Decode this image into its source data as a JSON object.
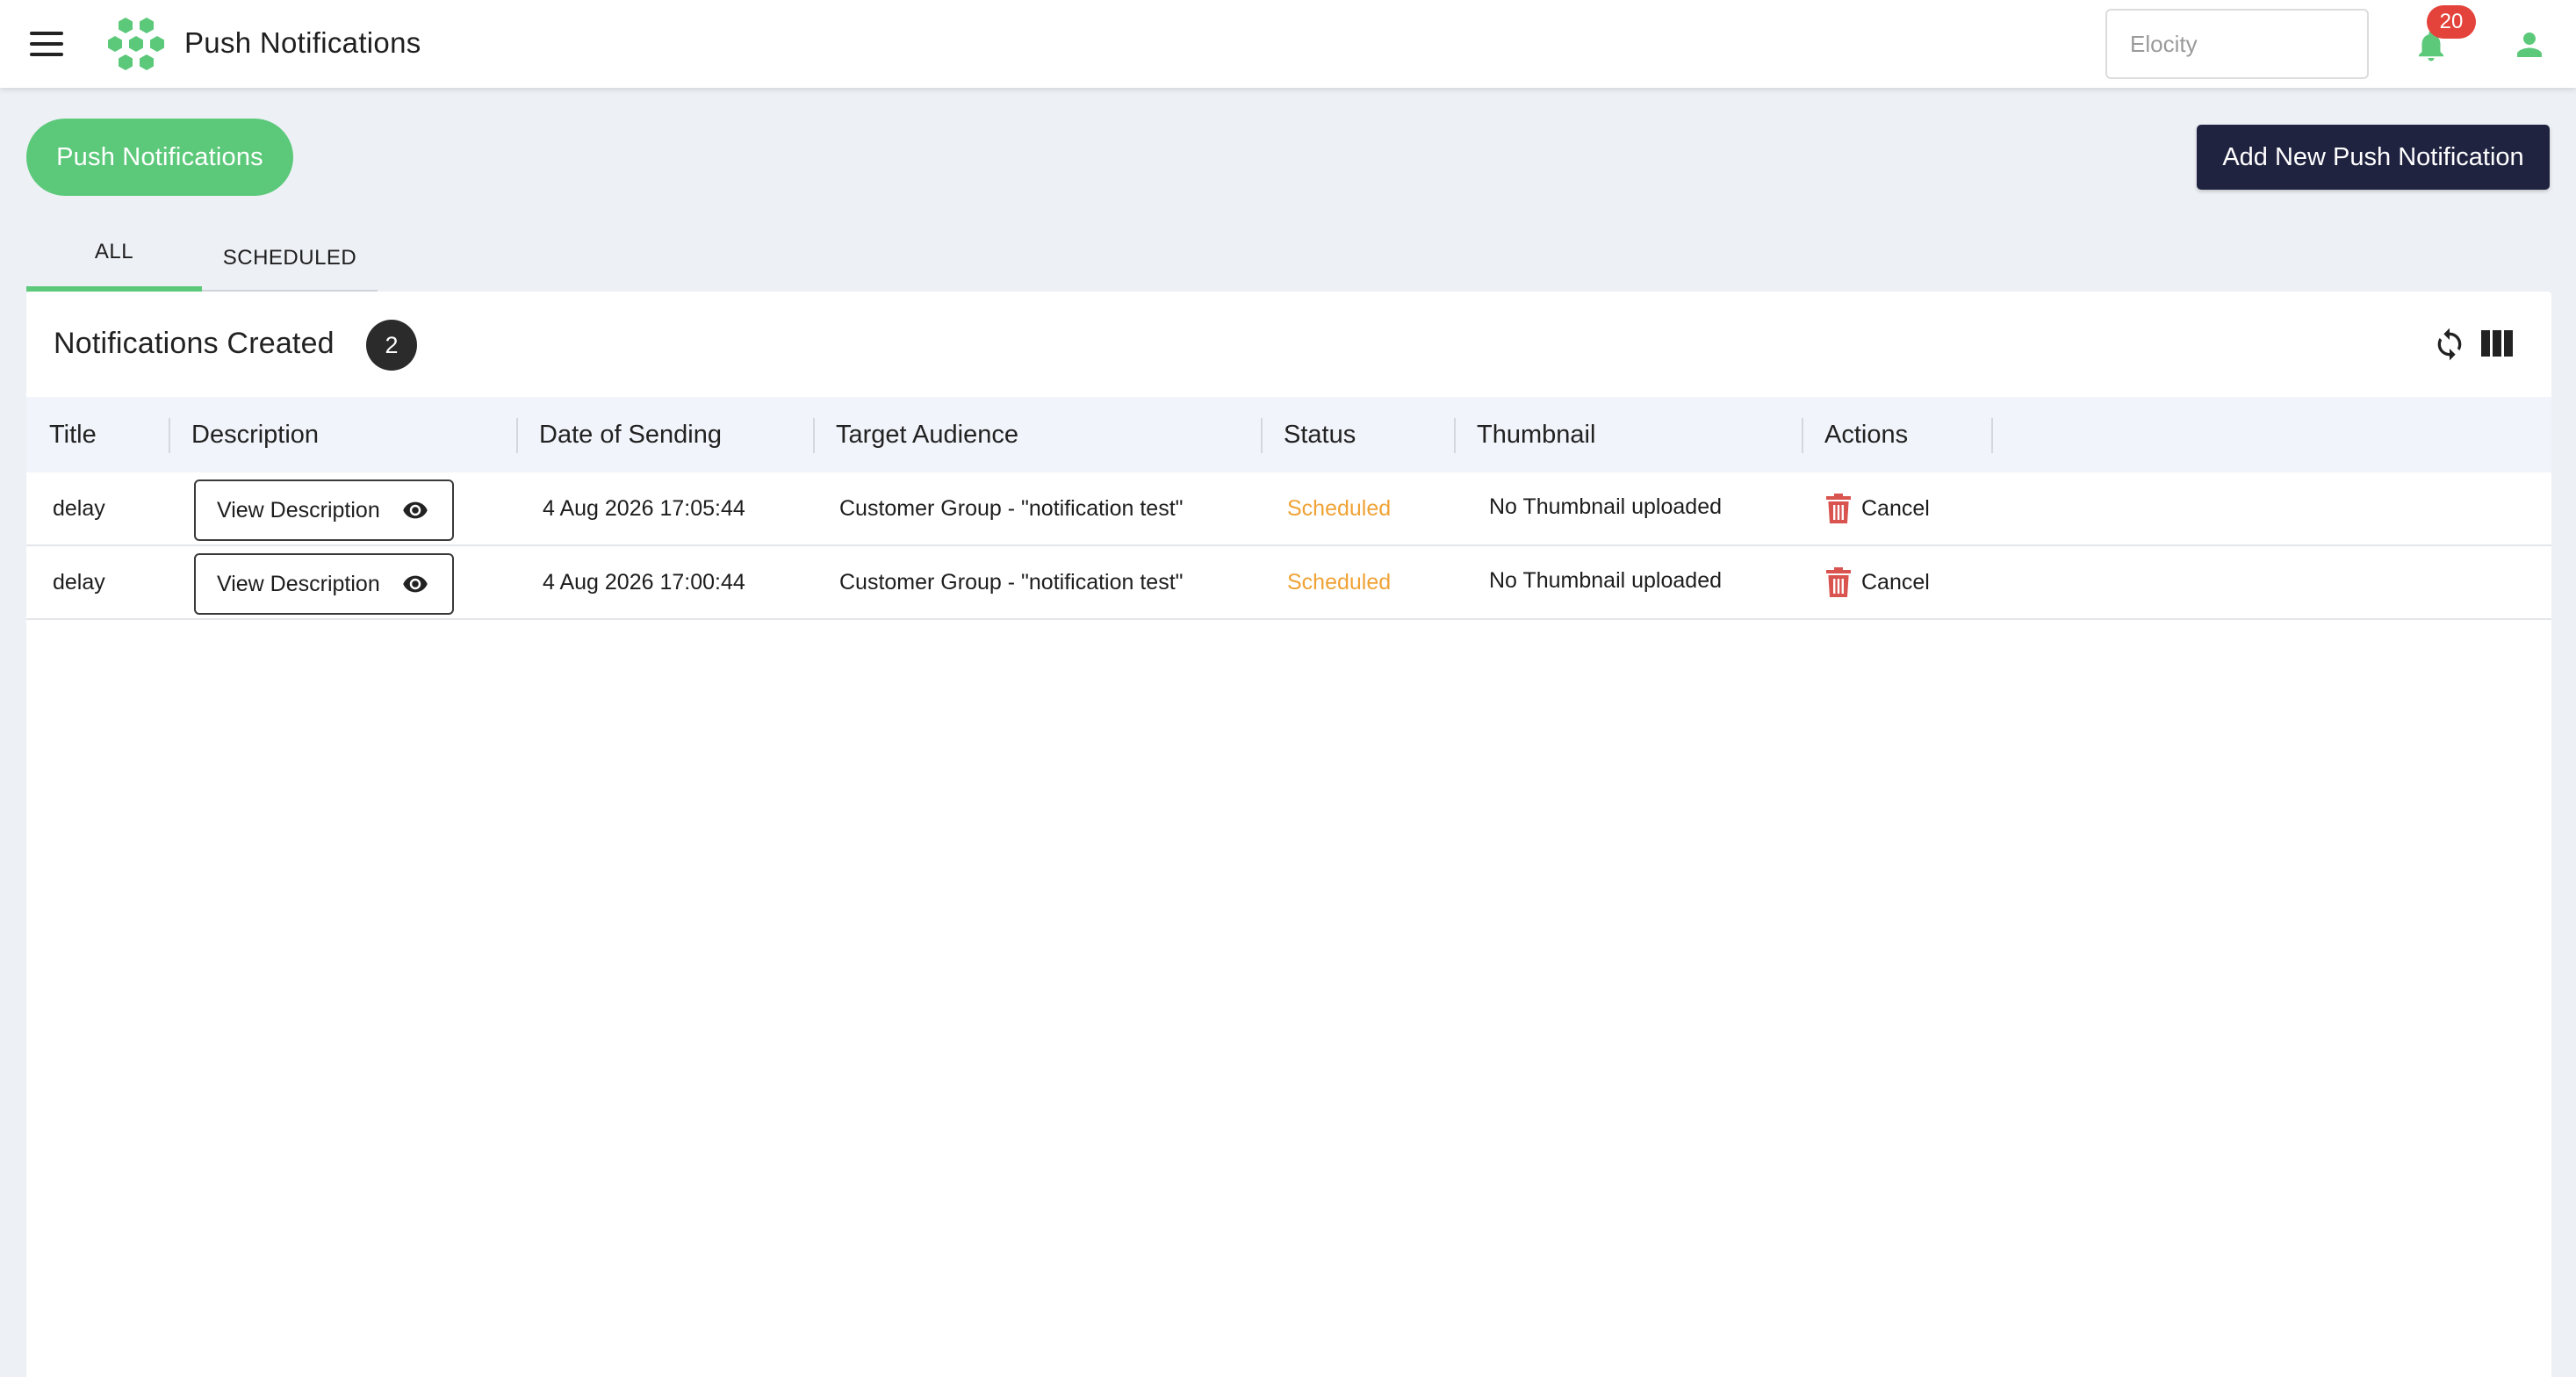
{
  "topbar": {
    "app_title": "Push Notifications",
    "org_placeholder": "Elocity",
    "notification_count": "20",
    "icons": [
      "menu-icon",
      "hexagon-logo",
      "bell-icon",
      "user-icon"
    ]
  },
  "page": {
    "pill_label": "Push Notifications",
    "add_button_label": "Add New Push Notification"
  },
  "tabs": [
    {
      "label": "ALL",
      "active": true
    },
    {
      "label": "SCHEDULED",
      "active": false
    }
  ],
  "card": {
    "title": "Notifications Created",
    "count": "2"
  },
  "table": {
    "columns": [
      "Title",
      "Description",
      "Date of Sending",
      "Target Audience",
      "Status",
      "Thumbnail",
      "Actions"
    ],
    "rows": [
      {
        "title": "delay",
        "description_button": "View Description",
        "date": "4 Aug 2026 17:05:44",
        "audience": "Customer Group - \"notification test\"",
        "status": "Scheduled",
        "thumbnail": "No Thumbnail uploaded",
        "action": "Cancel"
      },
      {
        "title": "delay",
        "description_button": "View Description",
        "date": "4 Aug 2026 17:00:44",
        "audience": "Customer Group - \"notification test\"",
        "status": "Scheduled",
        "thumbnail": "No Thumbnail uploaded",
        "action": "Cancel"
      }
    ]
  },
  "colors": {
    "accent_green": "#5cc97a",
    "navy": "#1f2340",
    "badge_red": "#e3433a",
    "status_scheduled": "#f0a234",
    "trash_red": "#d9534f"
  }
}
